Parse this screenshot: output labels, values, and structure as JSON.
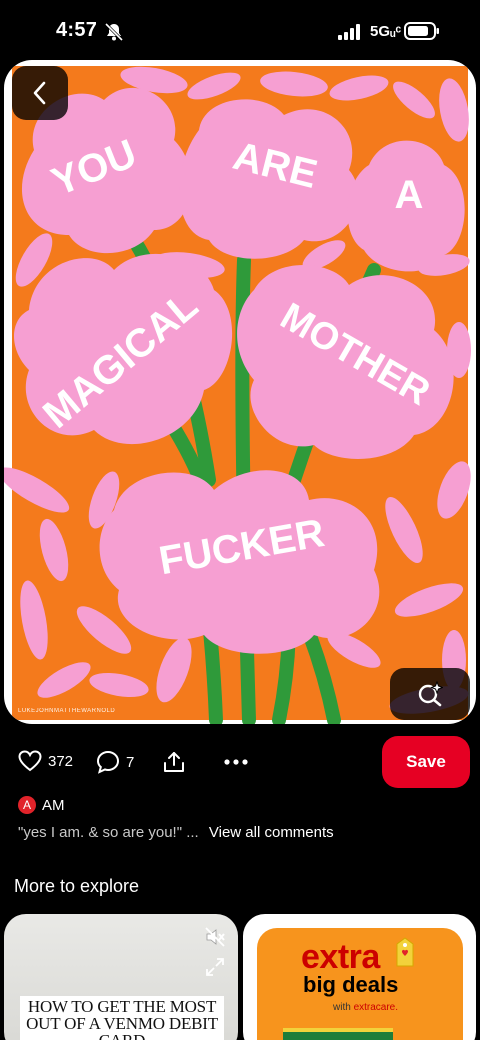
{
  "status_bar": {
    "time": "4:57",
    "network": "5Gᵤᶜ",
    "bell_icon": "bell-muted-icon",
    "signal_icon": "signal-bars-icon",
    "battery_icon": "battery-icon"
  },
  "pin": {
    "art_text": [
      "YOU",
      "ARE",
      "A",
      "MAGICAL",
      "MOTHER",
      "FUCKER"
    ],
    "watermark": "LUKEJOHNMATTHEWARNOLD",
    "colors": {
      "background": "#f47a1c",
      "petal": "#f69fd2",
      "stem": "#2f9a3a",
      "text": "#ffffff"
    },
    "back_icon": "chevron-left-icon",
    "visual_search_icon": "lens-sparkle-icon"
  },
  "actions": {
    "like_count": "372",
    "comment_count": "7",
    "like_icon": "heart-icon",
    "comment_icon": "comment-bubble-icon",
    "share_icon": "share-icon",
    "more_icon": "more-dots-icon",
    "save_label": "Save",
    "save_color": "#e60023"
  },
  "author": {
    "initial": "A",
    "name": "AM"
  },
  "comment": {
    "quote": "\"yes I am. & so are you!\" ...",
    "view_all": "View all comments"
  },
  "explore": {
    "title": "More to explore",
    "cards": [
      {
        "caption": "HOW TO GET THE MOST OUT OF A VENMO DEBIT CARD",
        "mute_icon": "speaker-muted-icon",
        "expand_icon": "expand-icon"
      },
      {
        "headline": "extra",
        "subhead": "big deals",
        "note_prefix": "with ",
        "note_brand": "extracare."
      }
    ]
  }
}
